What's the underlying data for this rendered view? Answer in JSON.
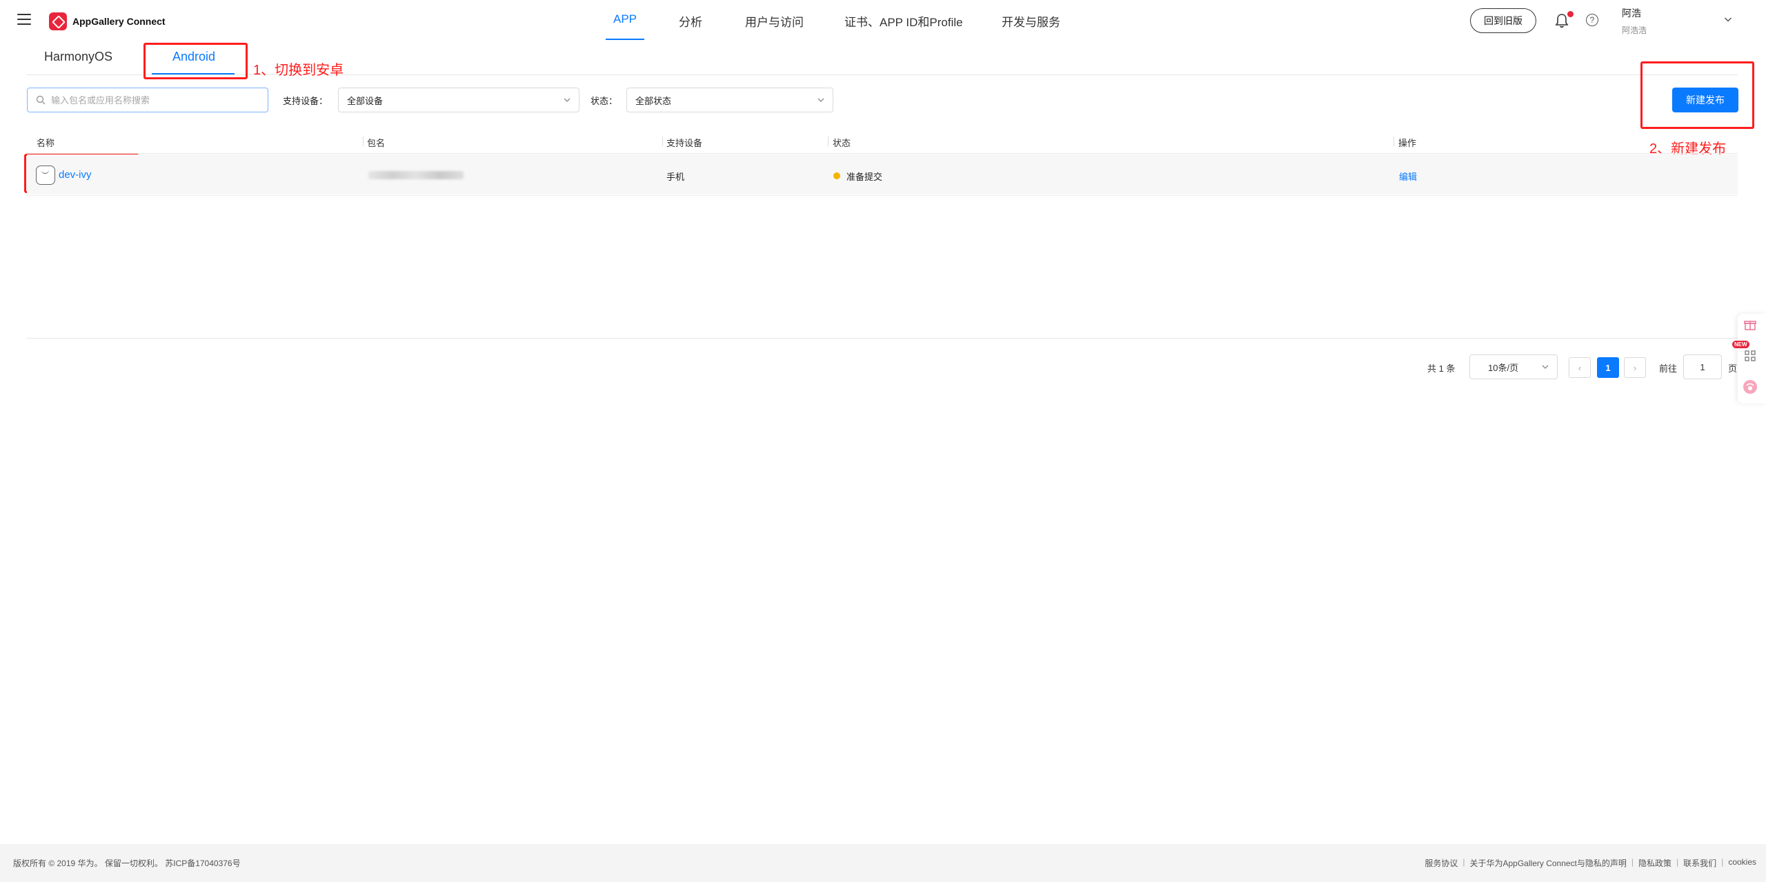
{
  "header": {
    "brand": "AppGallery Connect",
    "nav": [
      "APP",
      "分析",
      "用户与访问",
      "证书、APP ID和Profile",
      "开发与服务"
    ],
    "active_nav": "APP",
    "old_version_label": "回到旧版",
    "user_name": "阿浩",
    "user_sub": "阿浩浩",
    "colors": {
      "accent": "#0a7aff",
      "brand": "#e8253b"
    }
  },
  "platform_tabs": [
    "HarmonyOS",
    "Android"
  ],
  "active_platform": "Android",
  "annotations": {
    "step1": "1、切换到安卓",
    "step2": "2、新建发布"
  },
  "filters": {
    "search_placeholder": "输入包名或应用名称搜索",
    "device_label": "支持设备：",
    "device_value": "全部设备",
    "status_label": "状态：",
    "status_value": "全部状态"
  },
  "new_release_label": "新建发布",
  "table": {
    "columns": [
      "名称",
      "包名",
      "支持设备",
      "状态",
      "操作"
    ],
    "rows": [
      {
        "name": "dev-ivy",
        "device": "手机",
        "status": "准备提交",
        "action": "编辑"
      }
    ]
  },
  "pagination": {
    "total": "共 1 条",
    "page_size": "10条/页",
    "prev": "‹",
    "current_page": "1",
    "next": "›",
    "goto_label": "前往",
    "goto_value": "1",
    "page_unit": "页"
  },
  "side_tools": {
    "new_badge": "NEW"
  },
  "footer": {
    "copyright": "版权所有 © 2019 华为。 保留一切权利。 苏ICP备17040376号",
    "links": [
      "服务协议",
      "关于华为AppGallery Connect与隐私的声明",
      "隐私政策",
      "联系我们",
      "cookies"
    ]
  }
}
